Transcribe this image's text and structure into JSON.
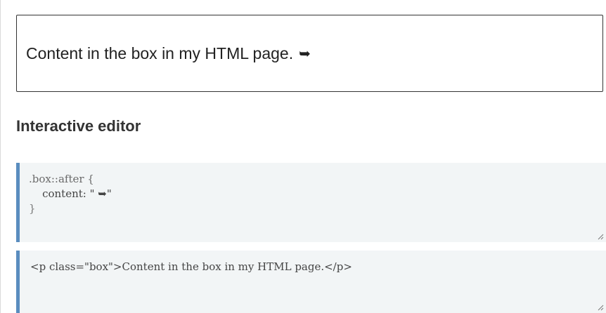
{
  "demo": {
    "box_text": "Content in the box in my HTML page.",
    "box_after_glyph": "➥"
  },
  "section": {
    "heading": "Interactive editor"
  },
  "css_editor": {
    "line1": ".box::after {",
    "line2_prop": "    content: ",
    "line2_value": "\" ➥\"",
    "line3": "}"
  },
  "html_editor": {
    "line1": "<p class=\"box\">Content in the box in my HTML page.</p>"
  },
  "colors": {
    "editor_bg": "#f2f5f6",
    "editor_accent": "#5a8dbf",
    "box_border": "#333333"
  }
}
